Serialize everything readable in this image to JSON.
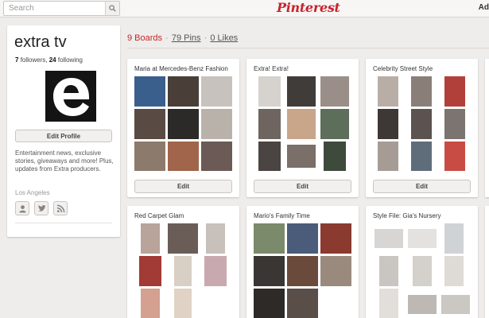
{
  "topbar": {
    "search_placeholder": "Search",
    "logo_text": "Pinterest",
    "right_label": "Ad",
    "search_icon": "magnifier-icon"
  },
  "profile": {
    "name": "extra tv",
    "followers_count": "7",
    "followers_label": "followers,",
    "following_count": "24",
    "following_label": "following",
    "avatar_letter": "e",
    "edit_label": "Edit Profile",
    "description": "Entertainment news, exclusive stories, giveaways and more! Plus, updates from Extra producers.",
    "location": "Los Angeles",
    "social_icons": [
      "profile-icon",
      "twitter-icon",
      "rss-icon"
    ]
  },
  "stats": {
    "boards": "9 Boards",
    "pins": "79 Pins",
    "likes": "0 Likes",
    "separator": "·"
  },
  "boards": [
    {
      "title": "Maria at Mercedes-Benz Fashion",
      "edit_label": "Edit"
    },
    {
      "title": "Extra! Extra!",
      "edit_label": "Edit"
    },
    {
      "title": "Celebrity Street Style",
      "edit_label": "Edit"
    },
    {
      "title": "Red Carpet Glam"
    },
    {
      "title": "Mario's Family Time"
    },
    {
      "title": "Style File: Gia's Nursery"
    }
  ],
  "colors": {
    "brand_red": "#c8232c",
    "background": "#efedeb",
    "card": "#ffffff"
  }
}
